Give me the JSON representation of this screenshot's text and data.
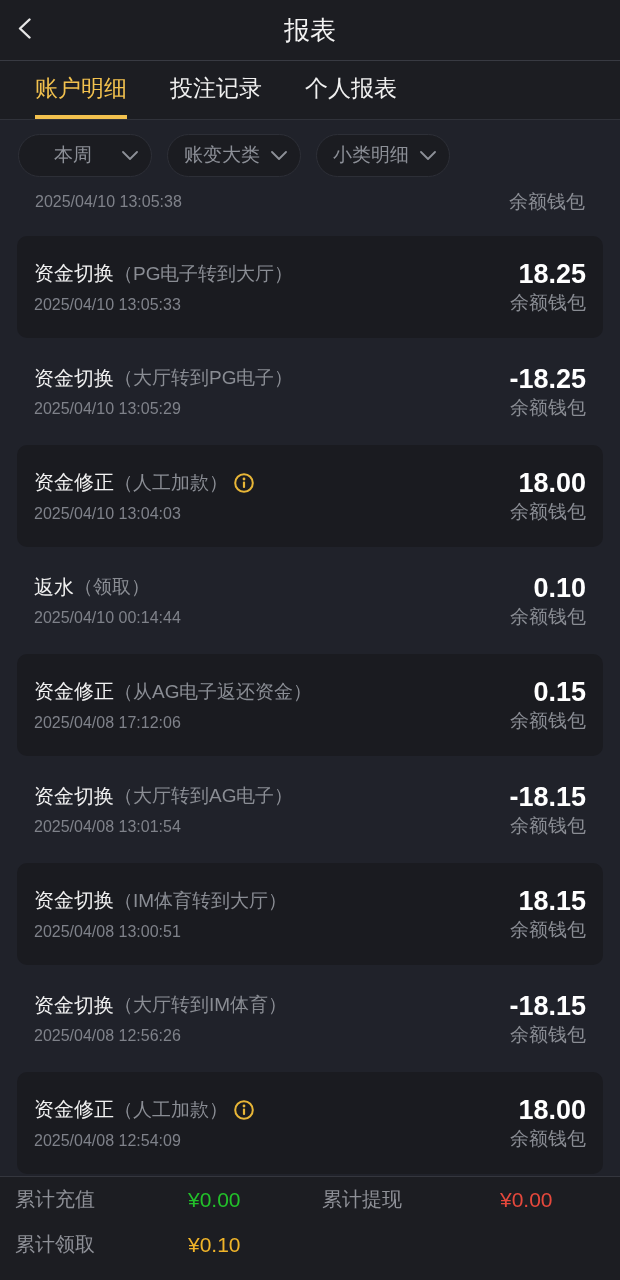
{
  "header": {
    "title": "报表"
  },
  "tabs": [
    {
      "label": "账户明细",
      "selected": true
    },
    {
      "label": "投注记录",
      "selected": false
    },
    {
      "label": "个人报表",
      "selected": false
    }
  ],
  "filters": [
    {
      "label": "本周"
    },
    {
      "label": "账变大类"
    },
    {
      "label": "小类明细"
    }
  ],
  "partial_row": {
    "time": "2025/04/10 13:05:38",
    "wallet": "余额钱包"
  },
  "records": [
    {
      "title": "资金切换",
      "detail": "（PG电子转到大厅）",
      "info": false,
      "time": "2025/04/10 13:05:33",
      "amount": "18.25",
      "wallet": "余额钱包"
    },
    {
      "title": "资金切换",
      "detail": "（大厅转到PG电子）",
      "info": false,
      "time": "2025/04/10 13:05:29",
      "amount": "-18.25",
      "wallet": "余额钱包"
    },
    {
      "title": "资金修正",
      "detail": "（人工加款）",
      "info": true,
      "time": "2025/04/10 13:04:03",
      "amount": "18.00",
      "wallet": "余额钱包"
    },
    {
      "title": "返水",
      "detail": "（领取）",
      "info": false,
      "time": "2025/04/10 00:14:44",
      "amount": "0.10",
      "wallet": "余额钱包"
    },
    {
      "title": "资金修正",
      "detail": "（从AG电子返还资金）",
      "info": false,
      "time": "2025/04/08 17:12:06",
      "amount": "0.15",
      "wallet": "余额钱包"
    },
    {
      "title": "资金切换",
      "detail": "（大厅转到AG电子）",
      "info": false,
      "time": "2025/04/08 13:01:54",
      "amount": "-18.15",
      "wallet": "余额钱包"
    },
    {
      "title": "资金切换",
      "detail": "（IM体育转到大厅）",
      "info": false,
      "time": "2025/04/08 13:00:51",
      "amount": "18.15",
      "wallet": "余额钱包"
    },
    {
      "title": "资金切换",
      "detail": "（大厅转到IM体育）",
      "info": false,
      "time": "2025/04/08 12:56:26",
      "amount": "-18.15",
      "wallet": "余额钱包"
    },
    {
      "title": "资金修正",
      "detail": "（人工加款）",
      "info": true,
      "time": "2025/04/08 12:54:09",
      "amount": "18.00",
      "wallet": "余额钱包"
    }
  ],
  "summary": [
    {
      "label": "累计充值",
      "value": "¥0.00",
      "color": "#22c02a"
    },
    {
      "label": "累计提现",
      "value": "¥0.00",
      "color": "#e5483c"
    },
    {
      "label": "累计领取",
      "value": "¥0.10",
      "color": "#f0b429"
    }
  ]
}
